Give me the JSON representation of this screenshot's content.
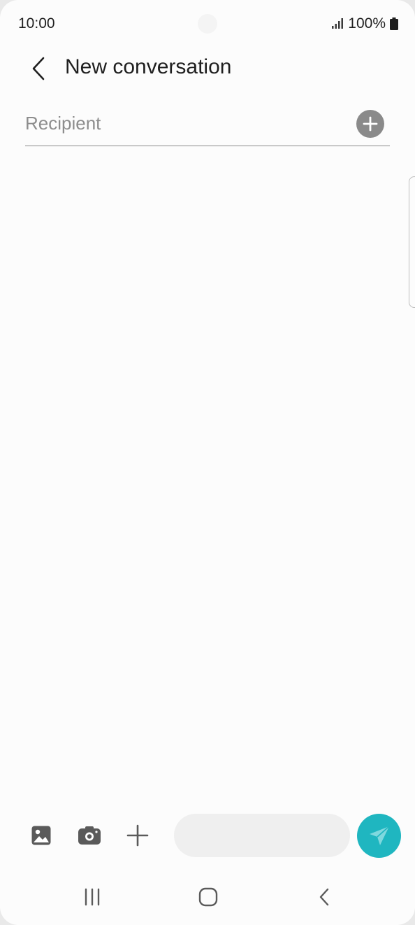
{
  "status_bar": {
    "time": "10:00",
    "battery_percent": "100%",
    "signal_icon": "signal-bars-icon",
    "battery_icon": "battery-full-icon"
  },
  "header": {
    "title": "New conversation",
    "back_icon": "chevron-left-icon"
  },
  "recipient": {
    "placeholder": "Recipient",
    "value": "",
    "add_icon": "plus-circle-icon"
  },
  "composer": {
    "message_value": "",
    "gallery_icon": "image-icon",
    "camera_icon": "camera-icon",
    "attach_icon": "plus-icon",
    "send_icon": "send-arrow-icon"
  },
  "nav_bar": {
    "recents_icon": "recents-icon",
    "home_icon": "home-icon",
    "back_icon": "back-icon"
  },
  "colors": {
    "background": "#fcfcfc",
    "accent": "#1fb6c0",
    "text": "#1f1f1f",
    "placeholder": "#8d8d8d"
  }
}
